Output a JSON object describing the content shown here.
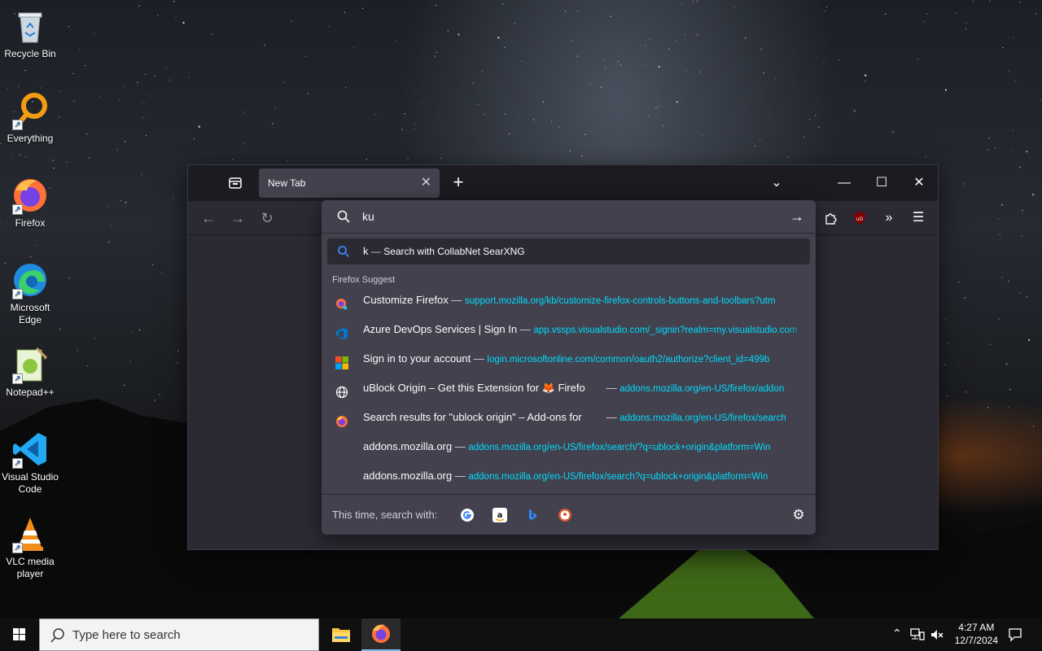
{
  "desktop": {
    "icons": [
      {
        "label": "Recycle Bin",
        "icon": "recycle-bin-icon"
      },
      {
        "label": "Everything",
        "icon": "everything-icon"
      },
      {
        "label": "Firefox",
        "icon": "firefox-icon"
      },
      {
        "label": "Microsoft Edge",
        "icon": "edge-icon"
      },
      {
        "label": "Notepad++",
        "icon": "notepadpp-icon"
      },
      {
        "label": "Visual Studio Code",
        "icon": "vscode-icon"
      },
      {
        "label": "VLC media player",
        "icon": "vlc-icon"
      }
    ]
  },
  "browser": {
    "tab_title": "New Tab",
    "urlbar": {
      "value": "ku",
      "heuristic": {
        "query": "k",
        "dash": "—",
        "text": "Search with CollabNet SearXNG"
      },
      "group_label": "Firefox Suggest",
      "results": [
        {
          "title": "Customize Firefox",
          "url": "support.mozilla.org/kb/customize-firefox-controls-buttons-and-toolbars?utm",
          "icon": "firefox-star-icon"
        },
        {
          "title": "Azure DevOps Services | Sign In",
          "url": "app.vssps.visualstudio.com/_signin?realm=my.visualstudio.com",
          "icon": "azure-devops-icon"
        },
        {
          "title": "Sign in to your account",
          "url": "login.microsoftonline.com/common/oauth2/authorize?client_id=499b",
          "icon": "microsoft-icon"
        },
        {
          "title": "uBlock Origin – Get this Extension for 🦊 Firefo",
          "url": "addons.mozilla.org/en-US/firefox/addon",
          "icon": "globe-icon"
        },
        {
          "title": "Search results for \"ublock origin\" – Add-ons for",
          "url": "addons.mozilla.org/en-US/firefox/search",
          "icon": "firefox-icon"
        },
        {
          "title": "addons.mozilla.org",
          "url": "addons.mozilla.org/en-US/firefox/search/?q=ublock+origin&platform=Win",
          "icon": ""
        },
        {
          "title": "addons.mozilla.org",
          "url": "addons.mozilla.org/en-US/firefox/search?q=ublock+origin&platform=Win",
          "icon": ""
        }
      ],
      "oneoff_label": "This time, search with:",
      "engines": [
        "google-icon",
        "amazon-icon",
        "bing-icon",
        "duckduckgo-icon"
      ]
    }
  },
  "taskbar": {
    "search_placeholder": "Type here to search",
    "time": "4:27 AM",
    "date": "12/7/2024"
  }
}
